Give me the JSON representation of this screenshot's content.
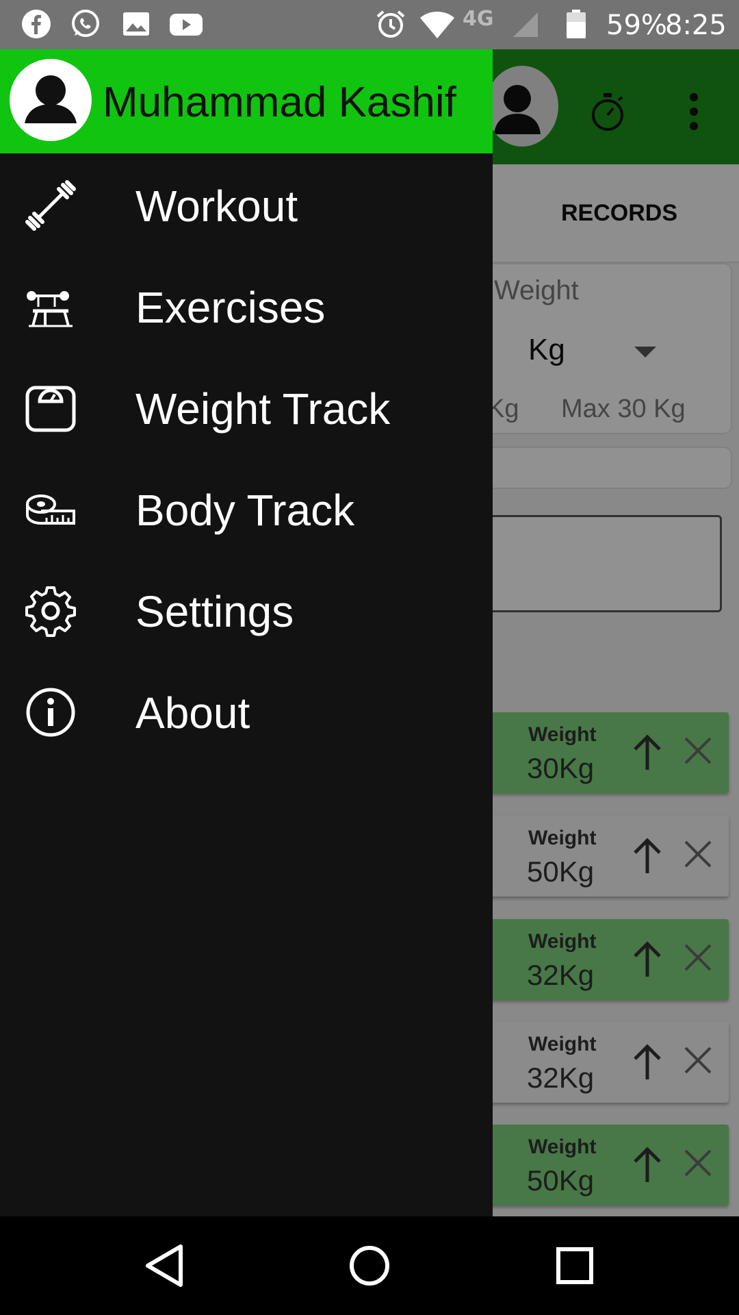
{
  "status_bar": {
    "battery_percent": "59%",
    "time": "8:25",
    "network": "4G",
    "icons": [
      "facebook-icon",
      "whatsapp-icon",
      "gallery-icon",
      "youtube-icon",
      "alarm-icon",
      "wifi-icon",
      "signal-icon",
      "battery-icon"
    ]
  },
  "drawer": {
    "user_name": "Muhammad Kashif",
    "items": [
      {
        "label": "Workout",
        "icon": "dumbbell-icon"
      },
      {
        "label": "Exercises",
        "icon": "bench-press-icon"
      },
      {
        "label": "Weight Track",
        "icon": "scale-icon"
      },
      {
        "label": "Body Track",
        "icon": "measuring-tape-icon"
      },
      {
        "label": "Settings",
        "icon": "gear-icon"
      },
      {
        "label": "About",
        "icon": "info-icon"
      }
    ]
  },
  "background_app": {
    "tab_records": "RECORDS",
    "weight_label": "Weight",
    "unit_value": "Kg",
    "min_label": "Kg",
    "max_label": "Max  30 Kg",
    "records": [
      {
        "label": "Weight",
        "value": "30Kg",
        "highlight": true
      },
      {
        "label": "Weight",
        "value": "50Kg",
        "highlight": false
      },
      {
        "label": "Weight",
        "value": "32Kg",
        "highlight": true
      },
      {
        "label": "Weight",
        "value": "32Kg",
        "highlight": false
      },
      {
        "label": "Weight",
        "value": "50Kg",
        "highlight": true
      }
    ]
  },
  "colors": {
    "drawer_header": "#10c410",
    "drawer_bg": "#121212",
    "app_bar": "#1a8f1a",
    "record_green": "#7ccf7a"
  }
}
